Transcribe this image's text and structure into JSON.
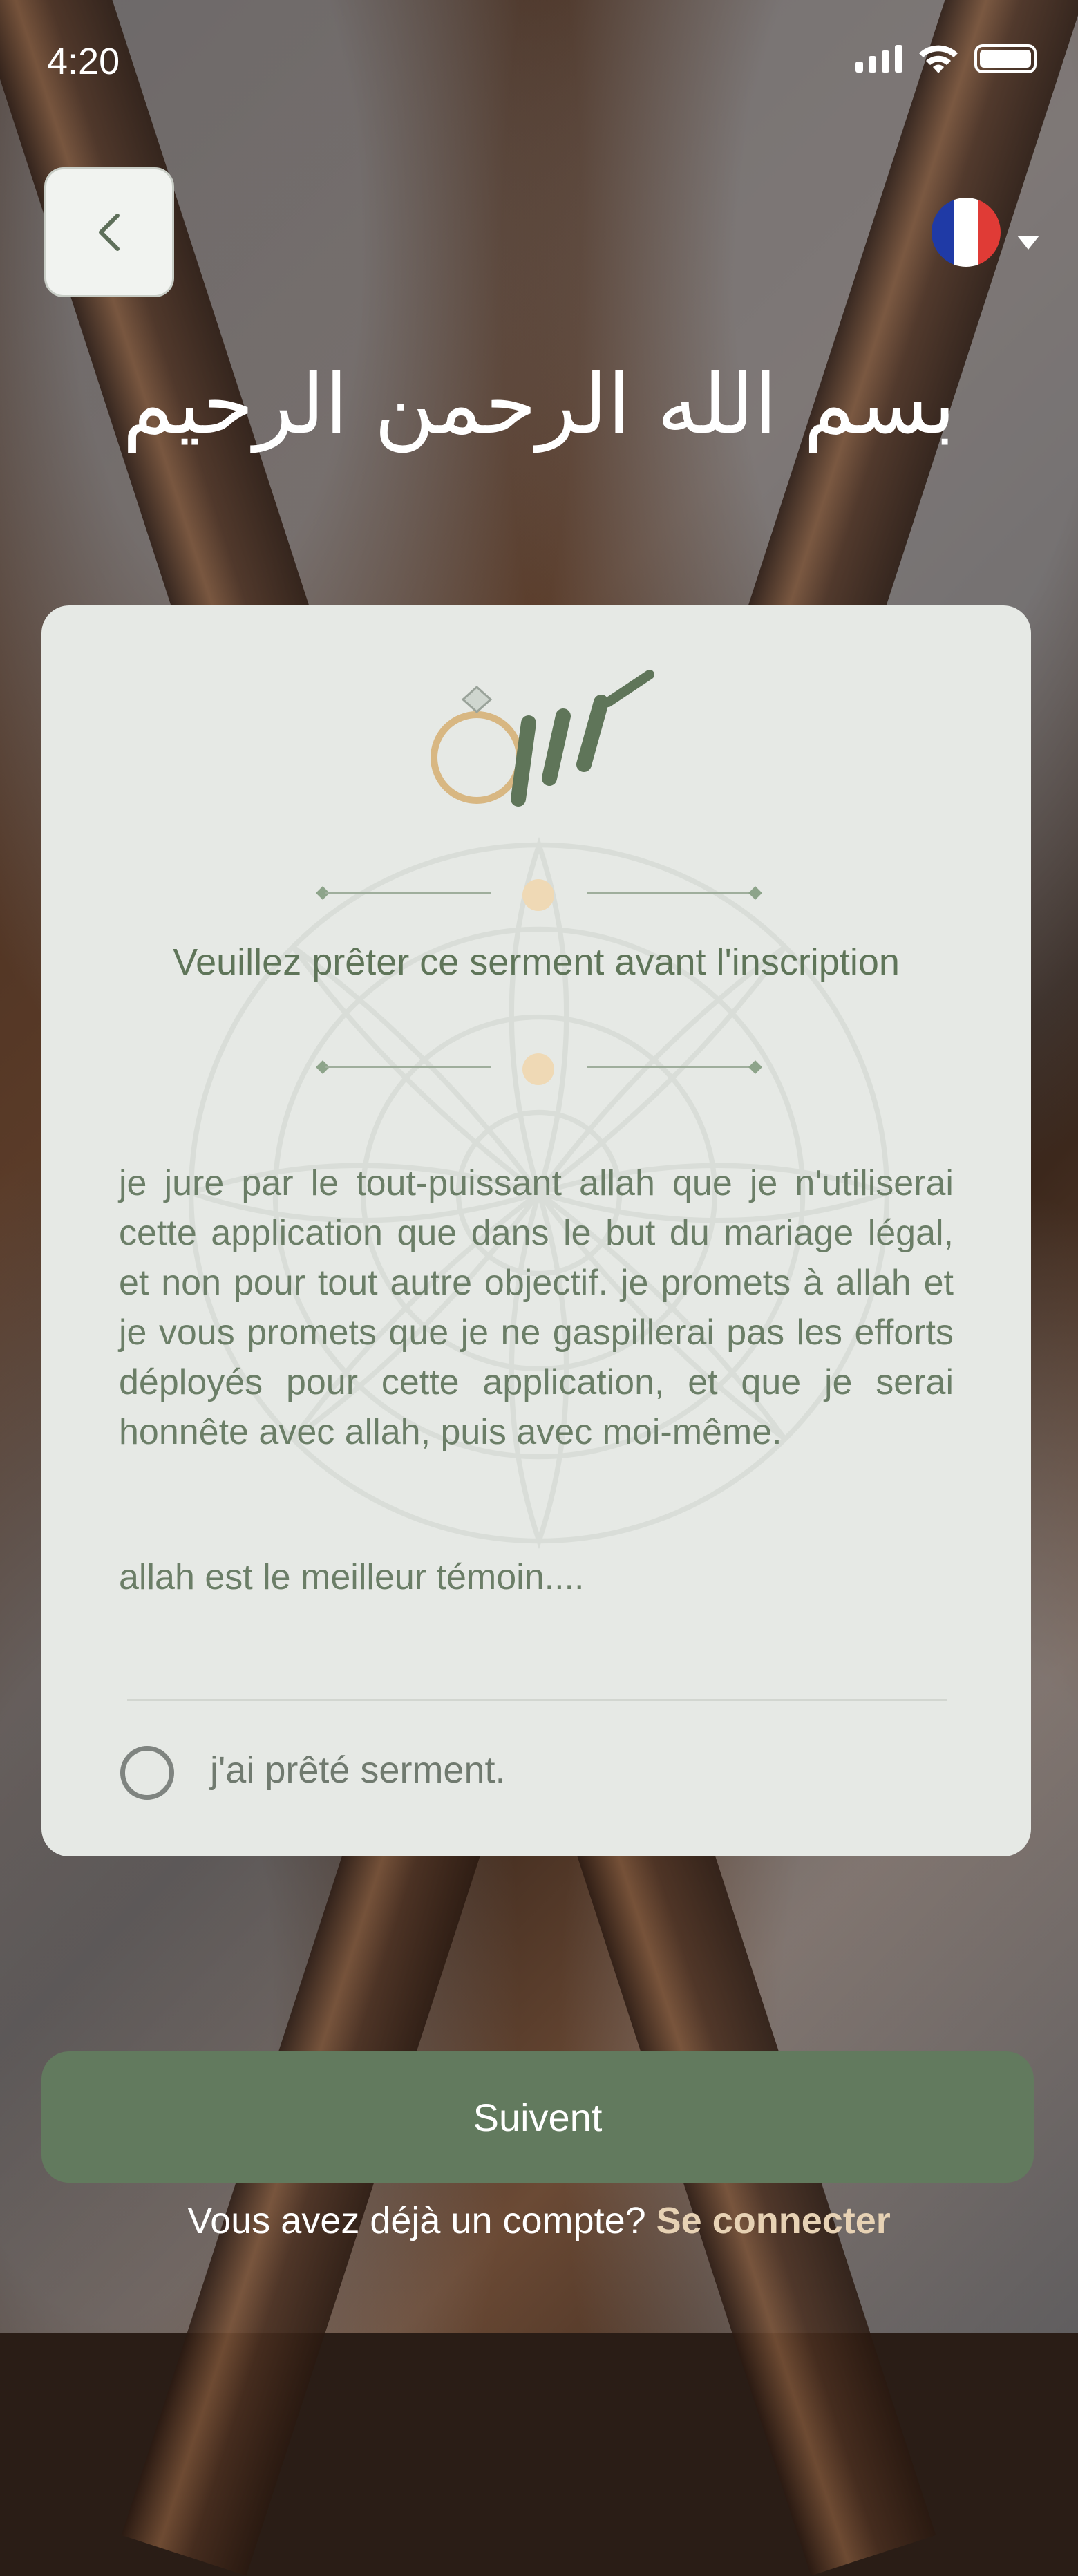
{
  "status": {
    "time": "4:20",
    "icons": [
      "signal-icon",
      "wifi-icon",
      "battery-icon"
    ]
  },
  "header": {
    "back_icon": "chevron-left-icon",
    "language_flag": "france-flag-icon",
    "language_caret": "caret-down-icon",
    "basmala": "بسم الله الرحمن الرحيم"
  },
  "card": {
    "title": "Veuillez prêter ce serment avant l'inscription",
    "oath": "je jure par le tout-puissant allah que je n'utiliserai cette application que dans le but du mariage légal, et non pour tout autre objectif. je promets à allah et je vous promets que je ne gaspillerai pas les efforts déployés pour cette application, et que je serai honnête avec allah, puis avec moi-même.",
    "witness": "allah est le meilleur témoin....",
    "checkbox_label": "j'ai prêté serment."
  },
  "actions": {
    "primary_button": "Suivent",
    "footer_prompt": "Vous avez déjà un compte?",
    "footer_link": "Se connecter"
  },
  "colors": {
    "accent": "#627a5e",
    "card_bg": "#e6e9e5",
    "text_green": "#5f7559",
    "link_beige": "#e7d2b4"
  }
}
